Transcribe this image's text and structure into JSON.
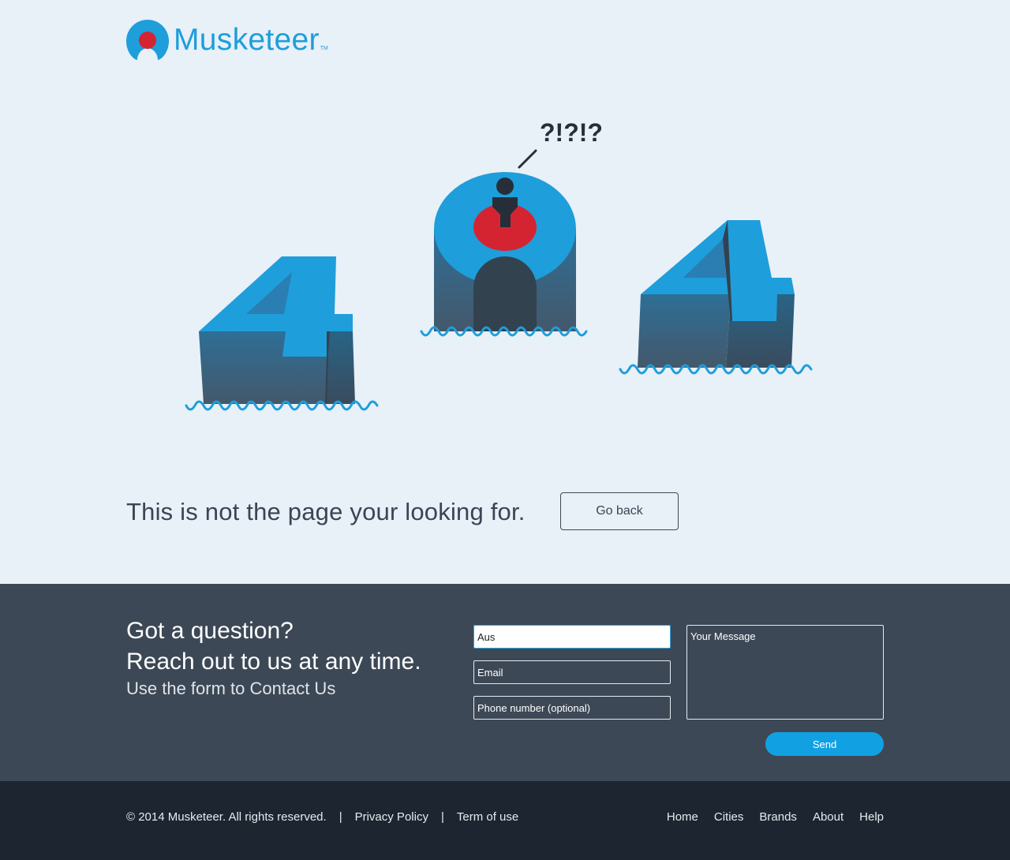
{
  "brand": {
    "name": "Musketeer",
    "tm": "TM",
    "primary_color": "#1e9edb",
    "accent_red": "#d42432"
  },
  "illustration": {
    "speech": "?!?!?",
    "left_digit": "4",
    "right_digit": "4",
    "icons": [
      "four-digit-left",
      "zero-with-person",
      "four-digit-right",
      "water-waves"
    ]
  },
  "error": {
    "message": "This is not the page your looking for.",
    "go_back_label": "Go back"
  },
  "contact": {
    "heading_line1": "Got a question?",
    "heading_line2": "Reach out to us at any time.",
    "subheading": "Use the form to Contact Us",
    "name_value": "Aus",
    "email_placeholder": "Email",
    "phone_placeholder": "Phone number (optional)",
    "message_placeholder": "Your Message",
    "send_label": "Send"
  },
  "footer": {
    "copyright": "© 2014 Musketeer. All rights reserved.",
    "sep": "|",
    "privacy": "Privacy Policy",
    "terms": "Term of use",
    "nav": [
      "Home",
      "Cities",
      "Brands",
      "About",
      "Help"
    ]
  },
  "colors": {
    "page_bg": "#e8f0f8",
    "contact_bg": "#3d4856",
    "footer_bg": "#1d2530",
    "send_bg": "#11a1e3"
  }
}
